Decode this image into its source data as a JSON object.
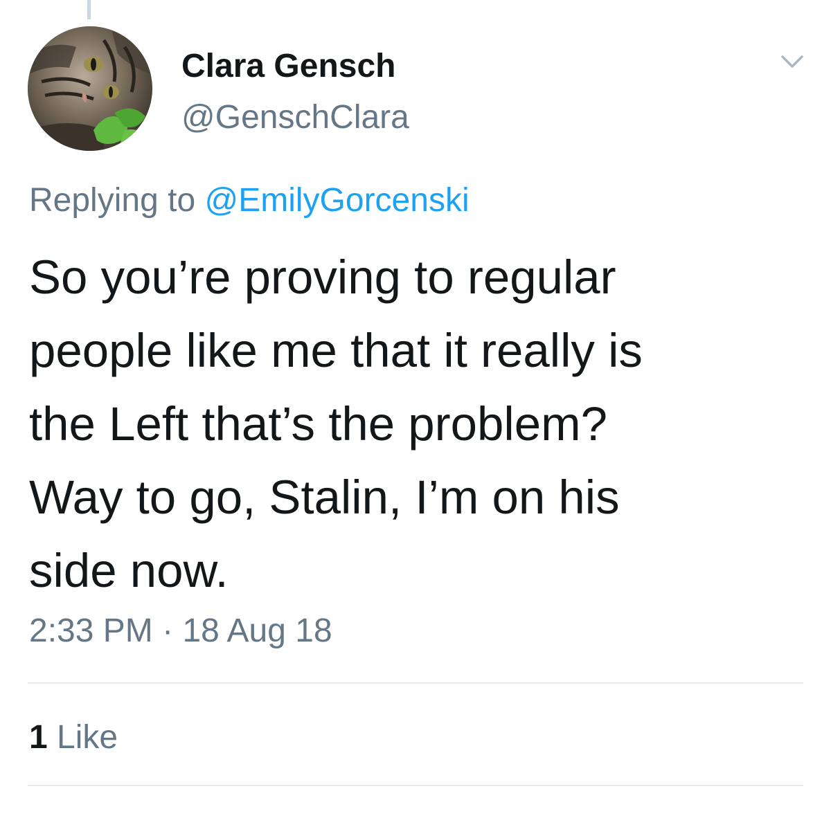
{
  "tweet": {
    "author": {
      "display_name": "Clara Gensch",
      "handle": "@GenschClara",
      "avatar_icon": "cat-avatar"
    },
    "reply_context": {
      "prefix": "Replying to",
      "mention": "@EmilyGorcenski"
    },
    "text_lines": [
      "So you’re proving to regular",
      "people like me that it really is",
      "the Left that’s the problem?",
      "Way to go, Stalin, I’m on his",
      "side now."
    ],
    "timestamp": {
      "time": "2:33 PM",
      "separator": "·",
      "date": "18 Aug 18"
    },
    "likes": {
      "count": "1",
      "label": "Like"
    },
    "menu_icon": "chevron-down-icon"
  },
  "colors": {
    "primary_text": "#14171a",
    "secondary_text": "#657786",
    "link": "#1da1f2",
    "divider": "#e6ecf0"
  }
}
